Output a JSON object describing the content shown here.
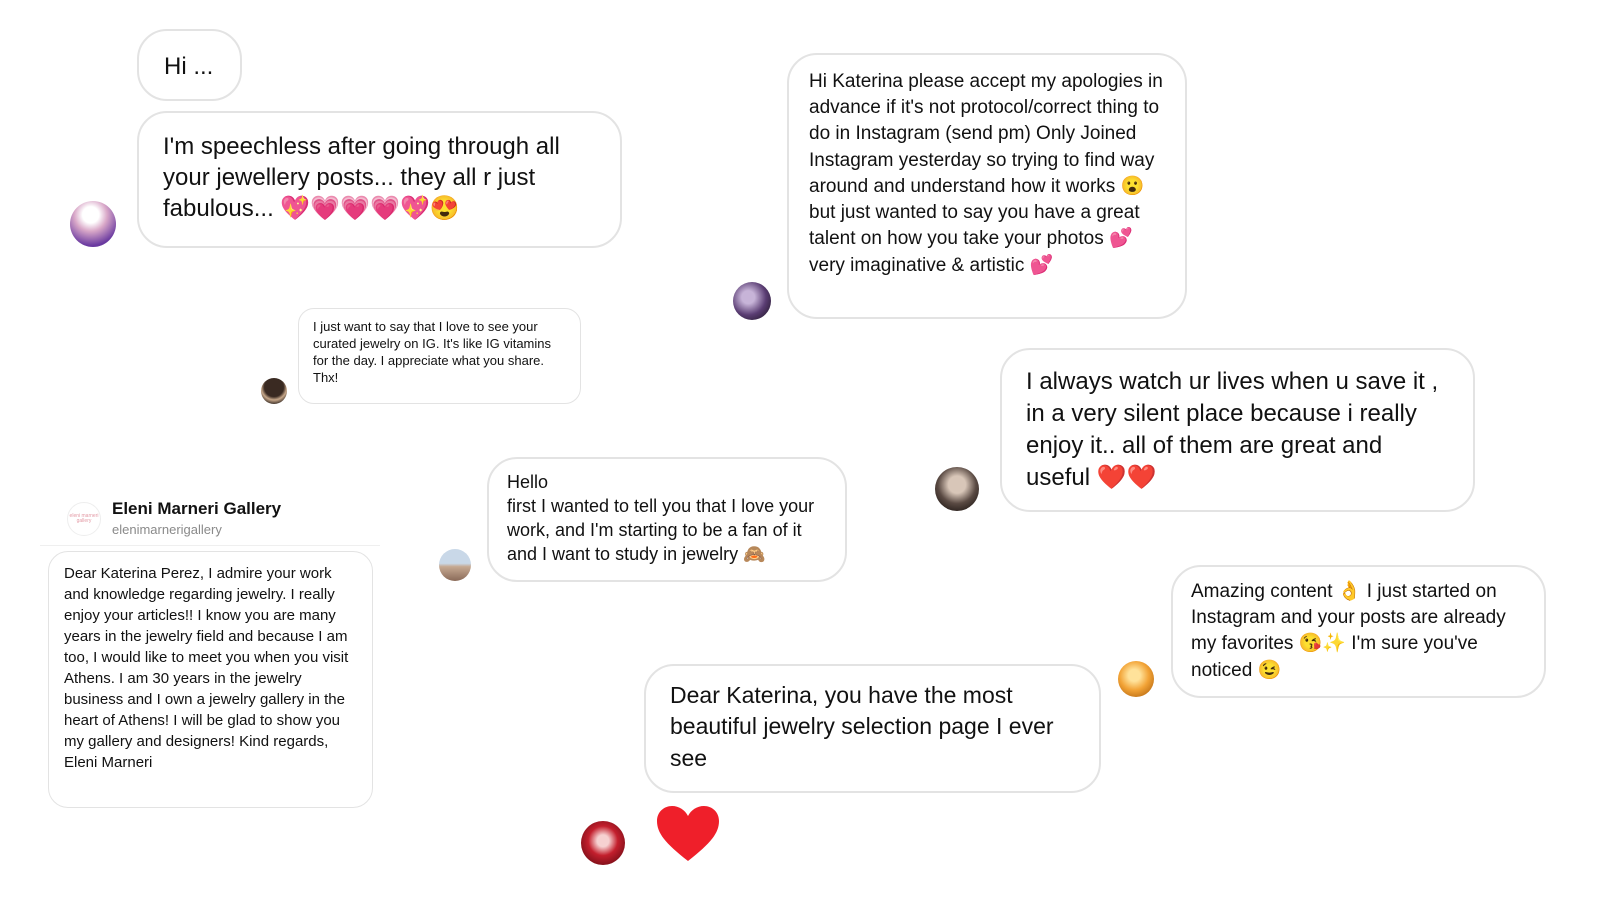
{
  "messages": {
    "m1": "Hi ...",
    "m2": "I'm speechless after going through all your jewellery posts... they all r just fabulous... 💖💗💗💗💖😍",
    "m3": "I just want to say that I love to see your curated jewelry on IG. It's like IG vitamins for the day. I appreciate what you share. Thx!",
    "m4": "Hi Katerina please accept my apologies in advance if it's not protocol/correct thing to do in Instagram (send pm) Only Joined Instagram yesterday so trying to find way around and understand how it works 😮 but just wanted to say you have a great talent on how you take your photos 💕 very imaginative & artistic 💕",
    "m5": "I always watch ur lives when u save it , in a very silent place because i really enjoy it.. all of them are great and useful ❤️❤️",
    "m6_line1": "Hello",
    "m6_line2": "first I wanted to tell you that I love your work, and I'm starting to be a fan of it and I want to study in jewelry 🙈",
    "m7": "Amazing content 👌 I just started on Instagram and your posts are already my favorites 😘✨ I'm sure you've noticed 😉",
    "m8": "Dear Katerina, you have the most beautiful jewelry selection page I ever see",
    "m9": "Dear Katerina Perez, I admire your work and knowledge regarding jewelry. I really enjoy your articles!! I know you are many years in the jewelry field and because I am too, I would like to meet you when you visit Athens. I am 30 years in the jewelry business and I own a jewelry gallery in the heart of Athens! I will be glad to show you my gallery and designers! Kind regards, Eleni Marneri"
  },
  "gallery": {
    "name": "Eleni Marneri Gallery",
    "handle": "elenimarnerigallery",
    "logo_text": "eleni marneri gallery"
  },
  "colors": {
    "bubble_border": "#e3e3e3",
    "heart": "#ef1f2a"
  }
}
